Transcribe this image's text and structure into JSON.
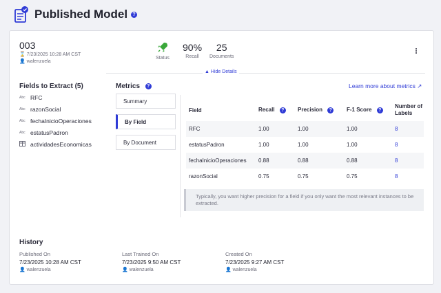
{
  "header": {
    "title": "Published Model",
    "help_icon": "?"
  },
  "model": {
    "id": "003",
    "date_time": "7/23/2025 10:28 AM CST",
    "user": "walenzuela",
    "stats": [
      {
        "value": "",
        "label": "Status",
        "icon": "rocket-icon"
      },
      {
        "value": "90%",
        "label": "Recall"
      },
      {
        "value": "25",
        "label": "Documents"
      }
    ],
    "hide_details": "Hide Details"
  },
  "fields": {
    "title": "Fields to Extract (5)",
    "items": [
      {
        "icon": "Abc",
        "label": "RFC"
      },
      {
        "icon": "Abc",
        "label": "razonSocial"
      },
      {
        "icon": "Abc",
        "label": "fechaInicioOperaciones"
      },
      {
        "icon": "Abc",
        "label": "estatusPadron"
      },
      {
        "icon": "table-icon",
        "label": "actividadesEconomicas"
      }
    ]
  },
  "metrics": {
    "title": "Metrics",
    "learn_more": "Learn more about metrics",
    "tabs": [
      "Summary",
      "By Field",
      "By Document"
    ],
    "active_tab": "By Field",
    "columns": [
      "Field",
      "Recall",
      "Precision",
      "F-1 Score",
      "Number of Labels"
    ],
    "rows": [
      {
        "field": "RFC",
        "recall": "1.00",
        "precision": "1.00",
        "f1": "1.00",
        "labels": "8"
      },
      {
        "field": "estatusPadron",
        "recall": "1.00",
        "precision": "1.00",
        "f1": "1.00",
        "labels": "8"
      },
      {
        "field": "fechaInicioOperaciones",
        "recall": "0.88",
        "precision": "0.88",
        "f1": "0.88",
        "labels": "8"
      },
      {
        "field": "razonSocial",
        "recall": "0.75",
        "precision": "0.75",
        "f1": "0.75",
        "labels": "8"
      }
    ],
    "note": "Typically, you want higher precision for a field if you only want the most relevant instances to be extracted."
  },
  "history": {
    "title": "History",
    "entries": [
      {
        "label": "Published On",
        "value": "7/23/2025 10:28 AM CST",
        "user": "walenzuela"
      },
      {
        "label": "Last Trained On",
        "value": "7/23/2025 9:50 AM CST",
        "user": "walenzuela"
      },
      {
        "label": "Created On",
        "value": "7/23/2025 9:27 AM CST",
        "user": "walenzuela"
      }
    ]
  },
  "colors": {
    "accent": "#2f3bd6",
    "success": "#3aa83a"
  }
}
